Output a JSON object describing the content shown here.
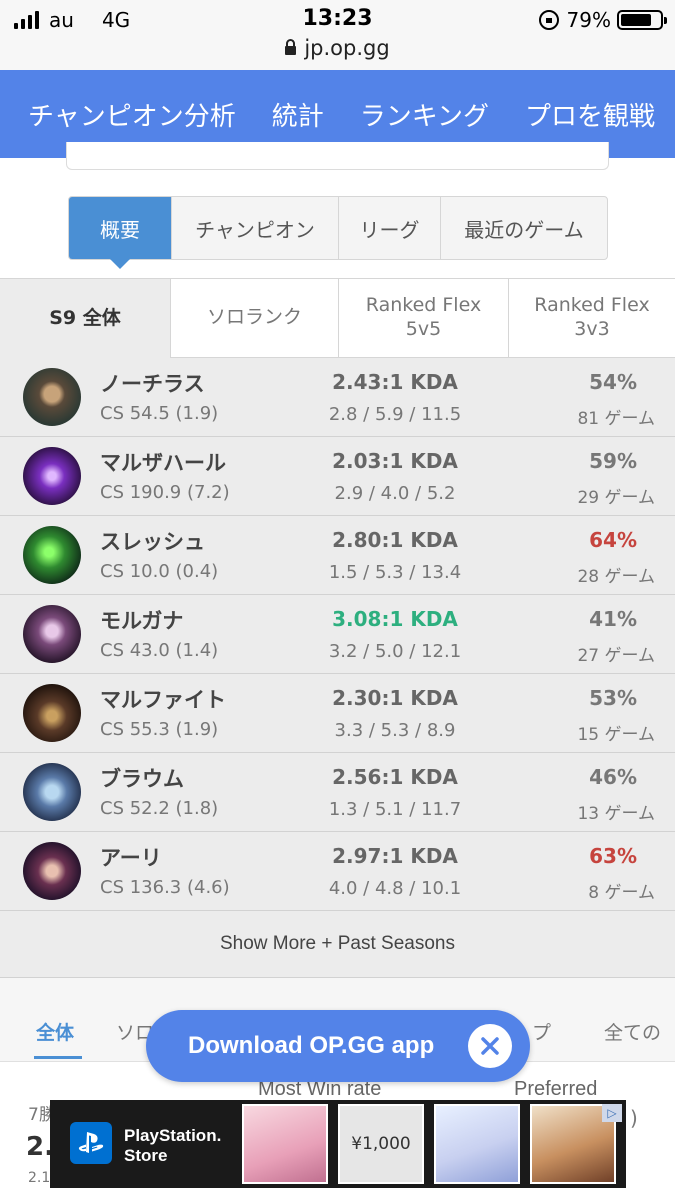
{
  "status_bar": {
    "carrier": "au",
    "network": "4G",
    "time": "13:23",
    "battery": "79%",
    "battery_level": 0.79,
    "url": "jp.op.gg"
  },
  "top_nav": [
    "チャンピオン分析",
    "統計",
    "ランキング",
    "プロを観戦"
  ],
  "tabs": [
    "概要",
    "チャンピオン",
    "リーグ",
    "最近のゲーム"
  ],
  "season_filters": [
    {
      "label": "S9 全体",
      "sub": ""
    },
    {
      "label": "ソロランク",
      "sub": ""
    },
    {
      "label": "Ranked Flex",
      "sub": "5v5"
    },
    {
      "label": "Ranked Flex",
      "sub": "3v3"
    }
  ],
  "champions": [
    {
      "name": "ノーチラス",
      "cs": "CS 54.5 (1.9)",
      "kda": "2.43:1 KDA",
      "score": "2.8 / 5.9 / 11.5",
      "winrate": "54%",
      "games": "81 ゲーム"
    },
    {
      "name": "マルザハール",
      "cs": "CS 190.9 (7.2)",
      "kda": "2.03:1 KDA",
      "score": "2.9 / 4.0 / 5.2",
      "winrate": "59%",
      "games": "29 ゲーム"
    },
    {
      "name": "スレッシュ",
      "cs": "CS 10.0 (0.4)",
      "kda": "2.80:1 KDA",
      "score": "1.5 / 5.3 / 13.4",
      "winrate": "64%",
      "games": "28 ゲーム"
    },
    {
      "name": "モルガナ",
      "cs": "CS 43.0 (1.4)",
      "kda": "3.08:1 KDA",
      "score": "3.2 / 5.0 / 12.1",
      "winrate": "41%",
      "games": "27 ゲーム"
    },
    {
      "name": "マルファイト",
      "cs": "CS 55.3 (1.9)",
      "kda": "2.30:1 KDA",
      "score": "3.3 / 5.3 / 8.9",
      "winrate": "53%",
      "games": "15 ゲーム"
    },
    {
      "name": "ブラウム",
      "cs": "CS 52.2 (1.8)",
      "kda": "2.56:1 KDA",
      "score": "1.3 / 5.1 / 11.7",
      "winrate": "46%",
      "games": "13 ゲーム"
    },
    {
      "name": "アーリ",
      "cs": "CS 136.3 (4.6)",
      "kda": "2.97:1 KDA",
      "score": "4.0 / 4.8 / 10.1",
      "winrate": "63%",
      "games": "8 ゲーム"
    }
  ],
  "show_more": "Show More + Past Seasons",
  "bottom_tabs": [
    "全体",
    "ソロ",
    "プ",
    "全ての"
  ],
  "stats_partial": {
    "most_win_rate": "Most Win rate",
    "preferred": "Preferred",
    "record": "7勝",
    "big": "2.",
    "small": "2.1",
    "paren": ")"
  },
  "download_banner": {
    "label": "Download OP.GG app"
  },
  "ad": {
    "brand_line1": "PlayStation.",
    "brand_line2": "Store",
    "price": "¥1,000"
  },
  "colors": {
    "nav_blue": "#5383e8",
    "tab_active": "#4a8fd4",
    "kda_good": "#2daf7f",
    "winrate_hot": "#c6443e"
  }
}
